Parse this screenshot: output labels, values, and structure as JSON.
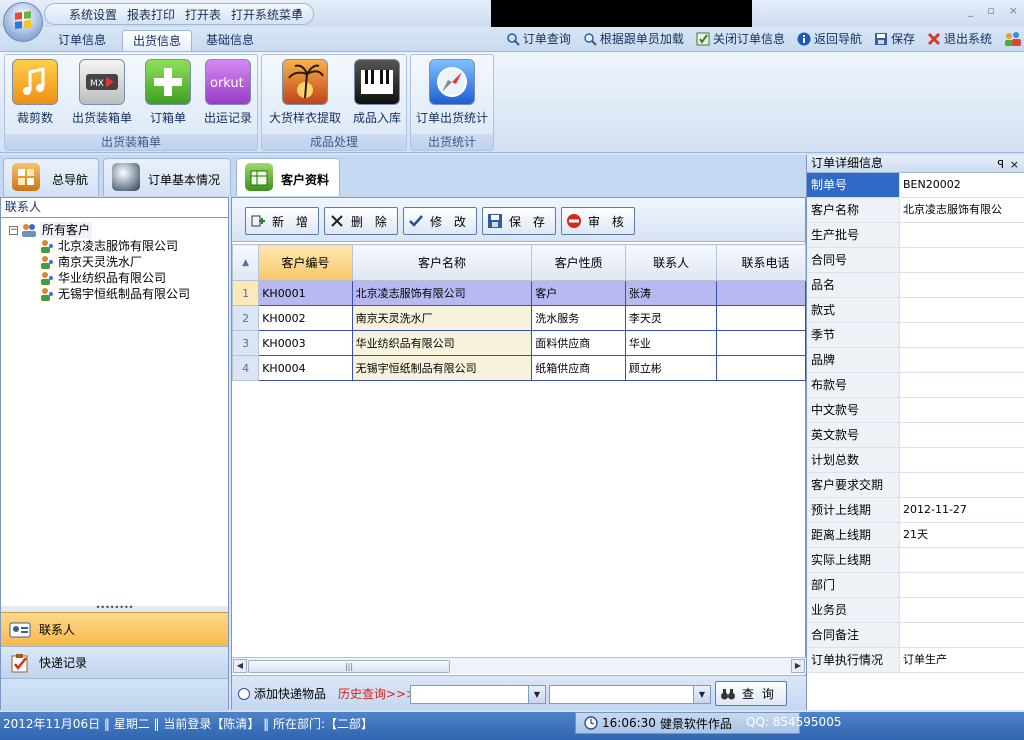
{
  "titlebar": {
    "quick_items": [
      "系统设置",
      "报表打印",
      "打开表",
      "打开系统菜单"
    ],
    "dropdown_glyph": "▾",
    "window_controls": [
      "_",
      "▫",
      "×"
    ]
  },
  "ribbon_tabs": [
    "订单信息",
    "出货信息",
    "基础信息"
  ],
  "commands": [
    {
      "label": "订单查询",
      "icon": "search-icon"
    },
    {
      "label": "根据跟单员加载",
      "icon": "load-icon"
    },
    {
      "label": "关闭订单信息",
      "icon": "close-order-icon"
    },
    {
      "label": "返回导航",
      "icon": "info-icon"
    },
    {
      "label": "保存",
      "icon": "save-icon"
    },
    {
      "label": "退出系统",
      "icon": "exit-icon"
    }
  ],
  "ribbon_groups": [
    {
      "label": "出货装箱单",
      "buttons": [
        "裁剪数",
        "出货装箱单",
        "订箱单",
        "出运记录"
      ]
    },
    {
      "label": "成品处理",
      "buttons": [
        "大货样衣提取",
        "成品入库"
      ]
    },
    {
      "label": "出货统计",
      "buttons": [
        "订单出货统计"
      ]
    }
  ],
  "colors": {
    "accent": "#3169c6",
    "selected_row": "#b9b9f2",
    "orange": "#f6b94b"
  },
  "nav_tabs": [
    "总导航",
    "订单基本情况",
    "客户资料"
  ],
  "left_panel": {
    "title": "联系人",
    "root": "所有客户",
    "root_toggle": "−",
    "children": [
      "北京凌志服饰有限公司",
      "南京天灵洗水厂",
      "华业纺织品有限公司",
      "无锡宇恒纸制品有限公司"
    ],
    "splitter": "••••••••",
    "nav_buttons": [
      "联系人",
      "快递记录"
    ]
  },
  "toolbar": [
    "新 增",
    "删 除",
    "修 改",
    "保 存",
    "审 核"
  ],
  "grid": {
    "sort_glyph": "▲",
    "columns": [
      "客户编号",
      "客户名称",
      "客户性质",
      "联系人",
      "联系电话"
    ],
    "rows": [
      {
        "n": "1",
        "id": "KH0001",
        "name": "北京凌志服饰有限公司",
        "type": "客户",
        "contact": "张涛",
        "phone": ""
      },
      {
        "n": "2",
        "id": "KH0002",
        "name": "南京天灵洗水厂",
        "type": "洗水服务",
        "contact": "李天灵",
        "phone": ""
      },
      {
        "n": "3",
        "id": "KH0003",
        "name": "华业纺织品有限公司",
        "type": "面料供应商",
        "contact": "华业",
        "phone": ""
      },
      {
        "n": "4",
        "id": "KH0004",
        "name": "无锡宇恒纸制品有限公司",
        "type": "纸箱供应商",
        "contact": "顾立彬",
        "phone": ""
      }
    ],
    "scroll_left": "◀",
    "scroll_right": "▶",
    "scroll_grip": "|||"
  },
  "bottom": {
    "radio_label": "添加快递物品",
    "history_label": "历史查询>>>",
    "combo_arrow": "▼",
    "query_button": "查  询"
  },
  "right_panel": {
    "title": "订单详细信息",
    "pin": "ꟼ",
    "close": "×",
    "fields": [
      {
        "label": "制单号",
        "value": "BEN20002"
      },
      {
        "label": "客户名称",
        "value": "北京凌志服饰有限公"
      },
      {
        "label": "生产批号",
        "value": ""
      },
      {
        "label": "合同号",
        "value": ""
      },
      {
        "label": "品名",
        "value": ""
      },
      {
        "label": "款式",
        "value": ""
      },
      {
        "label": "季节",
        "value": ""
      },
      {
        "label": "品牌",
        "value": ""
      },
      {
        "label": "布款号",
        "value": ""
      },
      {
        "label": "中文款号",
        "value": ""
      },
      {
        "label": "英文款号",
        "value": ""
      },
      {
        "label": "计划总数",
        "value": ""
      },
      {
        "label": "客户要求交期",
        "value": ""
      },
      {
        "label": "预计上线期",
        "value": "2012-11-27"
      },
      {
        "label": "距离上线期",
        "value": "21天"
      },
      {
        "label": "实际上线期",
        "value": ""
      },
      {
        "label": "部门",
        "value": ""
      },
      {
        "label": "业务员",
        "value": ""
      },
      {
        "label": "合同备注",
        "value": ""
      },
      {
        "label": "订单执行情况",
        "value": "订单生产"
      }
    ]
  },
  "status": {
    "left": "2012年11月06日 ‖ 星期二 ‖ 当前登录【陈清】 ‖ 所在部门:【二部】",
    "time": "16:06:30",
    "company": "健景软件作品",
    "qq": "QQ: 854595005"
  }
}
